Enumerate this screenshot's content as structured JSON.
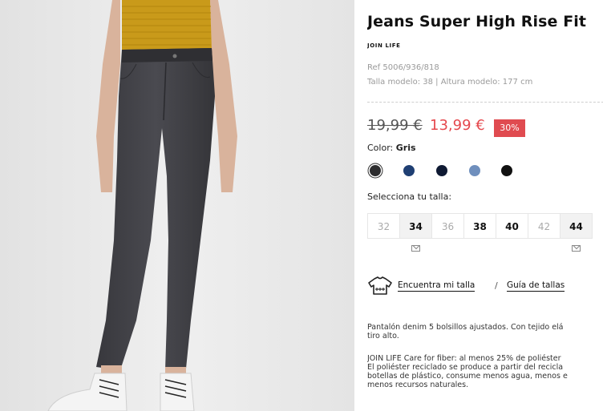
{
  "product": {
    "title": "Jeans Super High Rise Fit",
    "brand": "JOIN LIFE",
    "ref": "Ref 5006/936/818",
    "model_info": "Talla modelo: 38 | Altura modelo: 177 cm"
  },
  "price": {
    "old": "19,99 €",
    "new": "13,99 €",
    "discount": "30%"
  },
  "color": {
    "label": "Color:",
    "selected": "Gris",
    "swatches": [
      {
        "name": "gris",
        "hex": "#2d2d2f",
        "selected": true
      },
      {
        "name": "azul-oscuro",
        "hex": "#1f3f73",
        "selected": false
      },
      {
        "name": "azul-marino",
        "hex": "#0f1a33",
        "selected": false
      },
      {
        "name": "azul-claro",
        "hex": "#6f8fbd",
        "selected": false
      },
      {
        "name": "negro",
        "hex": "#111111",
        "selected": false
      }
    ]
  },
  "size": {
    "label": "Selecciona tu talla:",
    "options": [
      {
        "value": "32",
        "status": "unavailable"
      },
      {
        "value": "34",
        "status": "notify"
      },
      {
        "value": "36",
        "status": "unavailable"
      },
      {
        "value": "38",
        "status": "available"
      },
      {
        "value": "40",
        "status": "available"
      },
      {
        "value": "42",
        "status": "unavailable"
      },
      {
        "value": "44",
        "status": "notify"
      }
    ]
  },
  "links": {
    "find_size": "Encuentra mi talla",
    "separator": "/",
    "size_guide": "Guía de tallas"
  },
  "description": {
    "p1": [
      "Pantalón denim 5 bolsillos ajustados. Con tejido elá",
      "tiro alto."
    ],
    "p2": [
      "JOIN LIFE Care for fiber: al menos 25% de poliéster",
      "El poliéster reciclado se produce a partir del recicla",
      "botellas de plástico, consume menos agua, menos e",
      "menos recursos naturales."
    ]
  },
  "colors": {
    "accent_red": "#e5484d",
    "badge_red": "#e04b50",
    "photo_bg": "#ebebeb"
  }
}
